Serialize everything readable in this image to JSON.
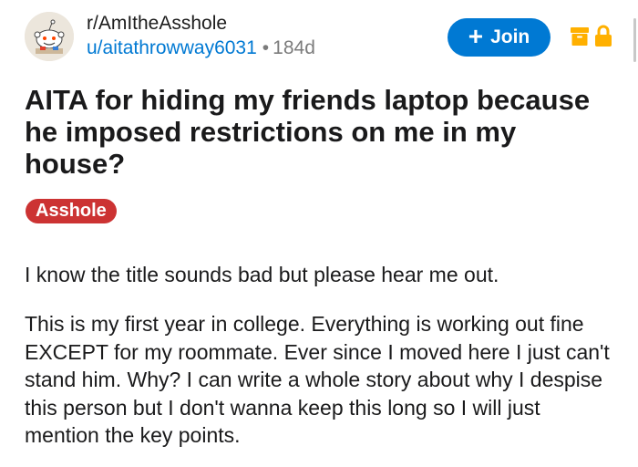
{
  "post": {
    "subreddit": "r/AmItheAsshole",
    "author": "u/aitathrowway6031",
    "separator": "•",
    "age": "184d",
    "title": "AITA for hiding my friends laptop because he imposed restrictions on me in my house?",
    "flair": "Asshole",
    "body": [
      "I know the title sounds bad but please hear me out.",
      "This is my first year in college. Everything is working out fine EXCEPT for my roommate. Ever since I moved here I just can't stand him. Why? I can write a whole story about why I despise this person but I don't wanna keep this long so I will just mention the key points."
    ]
  },
  "actions": {
    "join_icon": "+",
    "join_label": "Join",
    "archive_icon": "archive-box-icon",
    "lock_icon": "lock-icon"
  },
  "colors": {
    "join_blue": "#0079d3",
    "flair_red": "#cc3333",
    "status_orange": "#ffb000",
    "username_blue": "#0079d3",
    "meta_gray": "#7c7c7c"
  }
}
